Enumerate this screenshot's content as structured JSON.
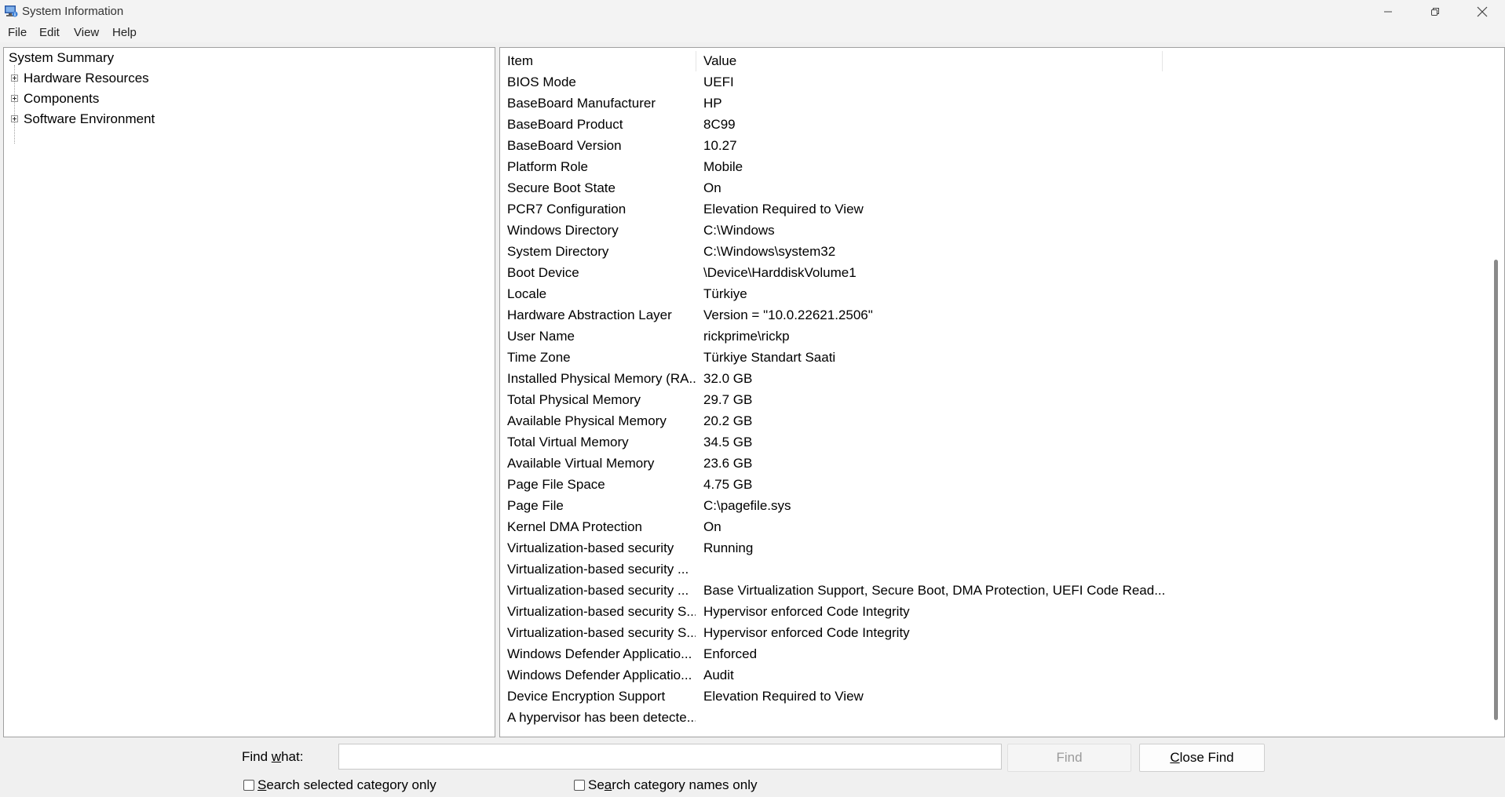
{
  "window": {
    "title": "System Information"
  },
  "menu": {
    "file": "File",
    "edit": "Edit",
    "view": "View",
    "help": "Help"
  },
  "tree": {
    "root": "System Summary",
    "children": [
      "Hardware Resources",
      "Components",
      "Software Environment"
    ]
  },
  "list": {
    "columns": {
      "item": "Item",
      "value": "Value"
    },
    "rows": [
      {
        "item": "BIOS Mode",
        "value": "UEFI"
      },
      {
        "item": "BaseBoard Manufacturer",
        "value": "HP"
      },
      {
        "item": "BaseBoard Product",
        "value": "8C99"
      },
      {
        "item": "BaseBoard Version",
        "value": "10.27"
      },
      {
        "item": "Platform Role",
        "value": "Mobile"
      },
      {
        "item": "Secure Boot State",
        "value": "On"
      },
      {
        "item": "PCR7 Configuration",
        "value": "Elevation Required to View"
      },
      {
        "item": "Windows Directory",
        "value": "C:\\Windows"
      },
      {
        "item": "System Directory",
        "value": "C:\\Windows\\system32"
      },
      {
        "item": "Boot Device",
        "value": "\\Device\\HarddiskVolume1"
      },
      {
        "item": "Locale",
        "value": "Türkiye"
      },
      {
        "item": "Hardware Abstraction Layer",
        "value": "Version = \"10.0.22621.2506\""
      },
      {
        "item": "User Name",
        "value": "rickprime\\rickp"
      },
      {
        "item": "Time Zone",
        "value": "Türkiye Standart Saati"
      },
      {
        "item": "Installed Physical Memory (RA...",
        "value": "32.0 GB"
      },
      {
        "item": "Total Physical Memory",
        "value": "29.7 GB"
      },
      {
        "item": "Available Physical Memory",
        "value": "20.2 GB"
      },
      {
        "item": "Total Virtual Memory",
        "value": "34.5 GB"
      },
      {
        "item": "Available Virtual Memory",
        "value": "23.6 GB"
      },
      {
        "item": "Page File Space",
        "value": "4.75 GB"
      },
      {
        "item": "Page File",
        "value": "C:\\pagefile.sys"
      },
      {
        "item": "Kernel DMA Protection",
        "value": "On"
      },
      {
        "item": "Virtualization-based security",
        "value": "Running"
      },
      {
        "item": "Virtualization-based security ...",
        "value": ""
      },
      {
        "item": "Virtualization-based security ...",
        "value": "Base Virtualization Support, Secure Boot, DMA Protection, UEFI Code Read..."
      },
      {
        "item": "Virtualization-based security S...",
        "value": "Hypervisor enforced Code Integrity"
      },
      {
        "item": "Virtualization-based security S...",
        "value": "Hypervisor enforced Code Integrity"
      },
      {
        "item": "Windows Defender Applicatio...",
        "value": "Enforced"
      },
      {
        "item": "Windows Defender Applicatio...",
        "value": "Audit"
      },
      {
        "item": "Device Encryption Support",
        "value": "Elevation Required to View"
      },
      {
        "item": "A hypervisor has been detecte...",
        "value": ""
      }
    ]
  },
  "find": {
    "label_pre": "Find ",
    "label_key": "w",
    "label_post": "hat:",
    "input_value": "",
    "find_button": "Find",
    "close_button_key": "C",
    "close_button_rest": "lose Find",
    "search_selected_pre": "S",
    "search_selected_rest": "earch selected category only",
    "search_names_pre": "Se",
    "search_names_key": "a",
    "search_names_rest": "rch category names only"
  }
}
